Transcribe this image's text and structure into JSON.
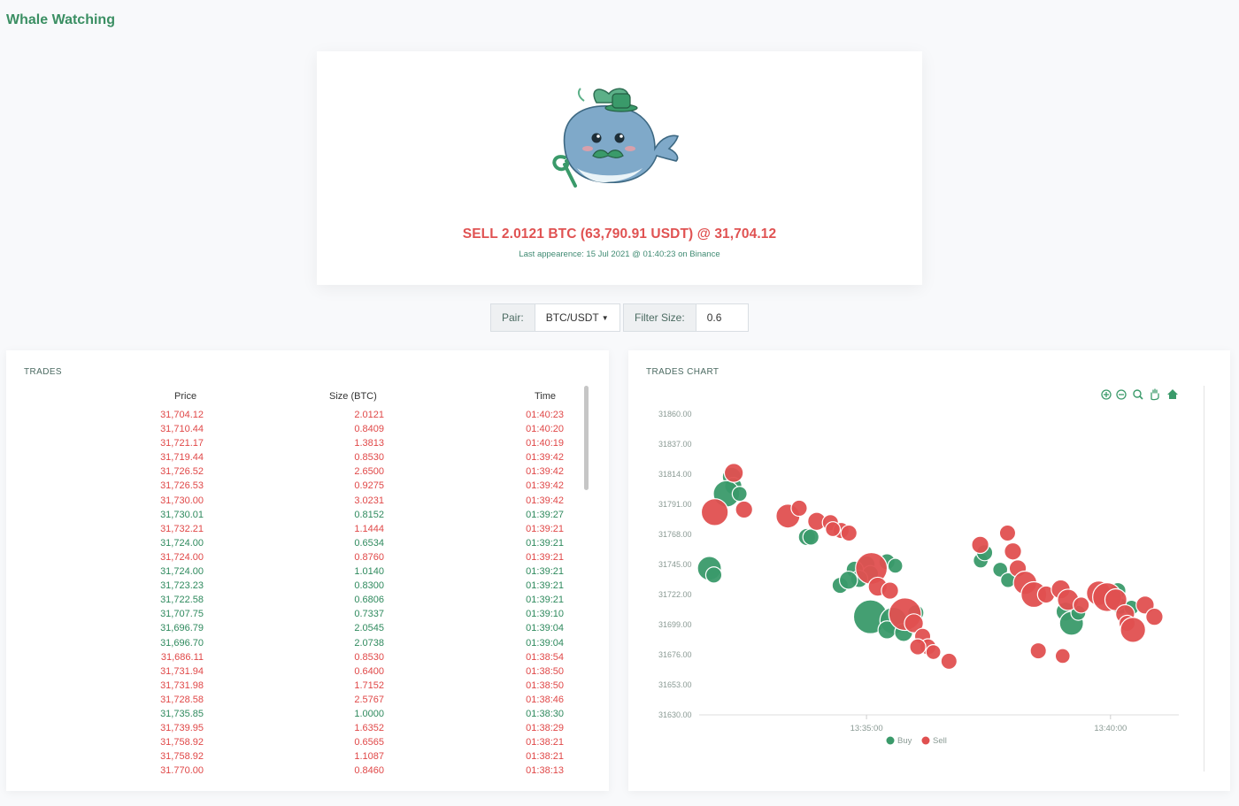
{
  "app": {
    "title": "Whale Watching"
  },
  "hero": {
    "trade_text": "SELL 2.0121 BTC (63,790.91 USDT) @ 31,704.12",
    "subtitle": "Last appearence: 15 Jul 2021 @ 01:40:23 on Binance",
    "trade_side_color": "#e05252"
  },
  "controls": {
    "pair_label": "Pair:",
    "pair_value": "BTC/USDT",
    "filter_label": "Filter Size:",
    "filter_value": "0.6"
  },
  "trades": {
    "title": "TRADES",
    "columns": [
      "Price",
      "Size (BTC)",
      "Time"
    ],
    "rows": [
      {
        "price": "31,704.12",
        "size": "2.0121",
        "time": "01:40:23",
        "side": "sell"
      },
      {
        "price": "31,710.44",
        "size": "0.8409",
        "time": "01:40:20",
        "side": "sell"
      },
      {
        "price": "31,721.17",
        "size": "1.3813",
        "time": "01:40:19",
        "side": "sell"
      },
      {
        "price": "31,719.44",
        "size": "0.8530",
        "time": "01:39:42",
        "side": "sell"
      },
      {
        "price": "31,726.52",
        "size": "2.6500",
        "time": "01:39:42",
        "side": "sell"
      },
      {
        "price": "31,726.53",
        "size": "0.9275",
        "time": "01:39:42",
        "side": "sell"
      },
      {
        "price": "31,730.00",
        "size": "3.0231",
        "time": "01:39:42",
        "side": "sell"
      },
      {
        "price": "31,730.01",
        "size": "0.8152",
        "time": "01:39:27",
        "side": "buy"
      },
      {
        "price": "31,732.21",
        "size": "1.1444",
        "time": "01:39:21",
        "side": "sell"
      },
      {
        "price": "31,724.00",
        "size": "0.6534",
        "time": "01:39:21",
        "side": "buy"
      },
      {
        "price": "31,724.00",
        "size": "0.8760",
        "time": "01:39:21",
        "side": "sell"
      },
      {
        "price": "31,724.00",
        "size": "1.0140",
        "time": "01:39:21",
        "side": "buy"
      },
      {
        "price": "31,723.23",
        "size": "0.8300",
        "time": "01:39:21",
        "side": "buy"
      },
      {
        "price": "31,722.58",
        "size": "0.6806",
        "time": "01:39:21",
        "side": "buy"
      },
      {
        "price": "31,707.75",
        "size": "0.7337",
        "time": "01:39:10",
        "side": "buy"
      },
      {
        "price": "31,696.79",
        "size": "2.0545",
        "time": "01:39:04",
        "side": "buy"
      },
      {
        "price": "31,696.70",
        "size": "2.0738",
        "time": "01:39:04",
        "side": "buy"
      },
      {
        "price": "31,686.11",
        "size": "0.8530",
        "time": "01:38:54",
        "side": "sell"
      },
      {
        "price": "31,731.94",
        "size": "0.6400",
        "time": "01:38:50",
        "side": "sell"
      },
      {
        "price": "31,731.98",
        "size": "1.7152",
        "time": "01:38:50",
        "side": "sell"
      },
      {
        "price": "31,728.58",
        "size": "2.5767",
        "time": "01:38:46",
        "side": "sell"
      },
      {
        "price": "31,735.85",
        "size": "1.0000",
        "time": "01:38:30",
        "side": "buy"
      },
      {
        "price": "31,739.95",
        "size": "1.6352",
        "time": "01:38:29",
        "side": "sell"
      },
      {
        "price": "31,758.92",
        "size": "0.6565",
        "time": "01:38:21",
        "side": "sell"
      },
      {
        "price": "31,758.92",
        "size": "1.1087",
        "time": "01:38:21",
        "side": "sell"
      },
      {
        "price": "31,770.00",
        "size": "0.8460",
        "time": "01:38:13",
        "side": "sell"
      }
    ]
  },
  "chart": {
    "title": "TRADES CHART",
    "toolbar_icons": [
      "zoom-in-icon",
      "zoom-out-icon",
      "magnify-icon",
      "pan-hand-icon",
      "home-icon"
    ]
  },
  "chart_data": {
    "type": "scatter",
    "title": "TRADES CHART",
    "xlabel": "",
    "ylabel": "",
    "y_ticks": [
      "31860.00",
      "31837.00",
      "31814.00",
      "31791.00",
      "31768.00",
      "31745.00",
      "31722.00",
      "31699.00",
      "31676.00",
      "31653.00",
      "31630.00"
    ],
    "ylim": [
      31630,
      31860
    ],
    "x_ticks": [
      {
        "label": "13:35:00",
        "minute": 35
      },
      {
        "label": "13:40:00",
        "minute": 40
      }
    ],
    "xlim": [
      31.57,
      41.4
    ],
    "grid": false,
    "legend": "bottom",
    "bubble_size": "trade size (BTC)",
    "series": [
      {
        "name": "Buy",
        "color": "#3a9a6a",
        "points": [
          [
            31.78,
            31742,
            1.5
          ],
          [
            31.87,
            31737,
            0.5
          ],
          [
            32.24,
            31812,
            0.8
          ],
          [
            32.27,
            31805,
            0.6
          ],
          [
            32.13,
            31799,
            1.9
          ],
          [
            32.4,
            31799,
            0.4
          ],
          [
            33.78,
            31766,
            0.6
          ],
          [
            33.86,
            31766,
            0.5
          ],
          [
            35.0,
            31745,
            0.6
          ],
          [
            35.08,
            31738,
            0.5
          ],
          [
            34.76,
            31741,
            0.6
          ],
          [
            34.85,
            31734,
            0.6
          ],
          [
            34.46,
            31729,
            0.5
          ],
          [
            34.63,
            31733,
            0.7
          ],
          [
            35.42,
            31747,
            0.5
          ],
          [
            35.59,
            31744,
            0.4
          ],
          [
            35.08,
            31705,
            3.5
          ],
          [
            35.55,
            31702,
            2.0
          ],
          [
            35.42,
            31695,
            0.7
          ],
          [
            35.76,
            31693,
            0.7
          ],
          [
            36.01,
            31708,
            0.5
          ],
          [
            37.34,
            31748,
            0.4
          ],
          [
            37.42,
            31754,
            0.5
          ],
          [
            37.74,
            31741,
            0.4
          ],
          [
            37.9,
            31733,
            0.4
          ],
          [
            39.08,
            31709,
            0.8
          ],
          [
            39.2,
            31700,
            1.5
          ],
          [
            39.34,
            31708,
            0.4
          ],
          [
            39.86,
            31722,
            0.4
          ],
          [
            40.15,
            31725,
            0.5
          ],
          [
            40.2,
            31713,
            0.5
          ],
          [
            40.43,
            31712,
            0.4
          ]
        ]
      },
      {
        "name": "Sell",
        "color": "#e05050",
        "points": [
          [
            32.28,
            31815,
            0.8
          ],
          [
            31.89,
            31785,
            2.0
          ],
          [
            32.49,
            31787,
            0.6
          ],
          [
            33.39,
            31782,
            1.5
          ],
          [
            33.62,
            31788,
            0.5
          ],
          [
            33.98,
            31778,
            0.7
          ],
          [
            34.26,
            31777,
            0.5
          ],
          [
            34.48,
            31771,
            0.5
          ],
          [
            34.31,
            31772,
            0.4
          ],
          [
            34.64,
            31769,
            0.5
          ],
          [
            35.1,
            31742,
            3.0
          ],
          [
            35.23,
            31728,
            0.8
          ],
          [
            35.48,
            31725,
            0.6
          ],
          [
            35.79,
            31707,
            3.2
          ],
          [
            35.97,
            31700,
            0.8
          ],
          [
            36.15,
            31690,
            0.5
          ],
          [
            36.26,
            31682,
            0.5
          ],
          [
            36.37,
            31678,
            0.4
          ],
          [
            37.33,
            31760,
            0.6
          ],
          [
            37.89,
            31769,
            0.5
          ],
          [
            38.0,
            31755,
            0.6
          ],
          [
            38.1,
            31742,
            0.6
          ],
          [
            38.25,
            31731,
            1.4
          ],
          [
            38.43,
            31722,
            1.8
          ],
          [
            38.68,
            31722,
            0.6
          ],
          [
            38.98,
            31726,
            0.8
          ],
          [
            39.13,
            31718,
            1.1
          ],
          [
            39.4,
            31714,
            0.5
          ],
          [
            39.76,
            31723,
            1.6
          ],
          [
            39.93,
            31720,
            2.4
          ],
          [
            40.11,
            31718,
            1.2
          ],
          [
            40.3,
            31707,
            0.8
          ],
          [
            40.34,
            31700,
            0.5
          ],
          [
            40.46,
            31695,
            1.7
          ],
          [
            40.71,
            31714,
            0.7
          ],
          [
            40.9,
            31705,
            0.6
          ],
          [
            36.69,
            31671,
            0.5
          ],
          [
            38.52,
            31679,
            0.5
          ],
          [
            39.02,
            31675,
            0.4
          ],
          [
            36.05,
            31682,
            0.5
          ]
        ]
      }
    ]
  }
}
